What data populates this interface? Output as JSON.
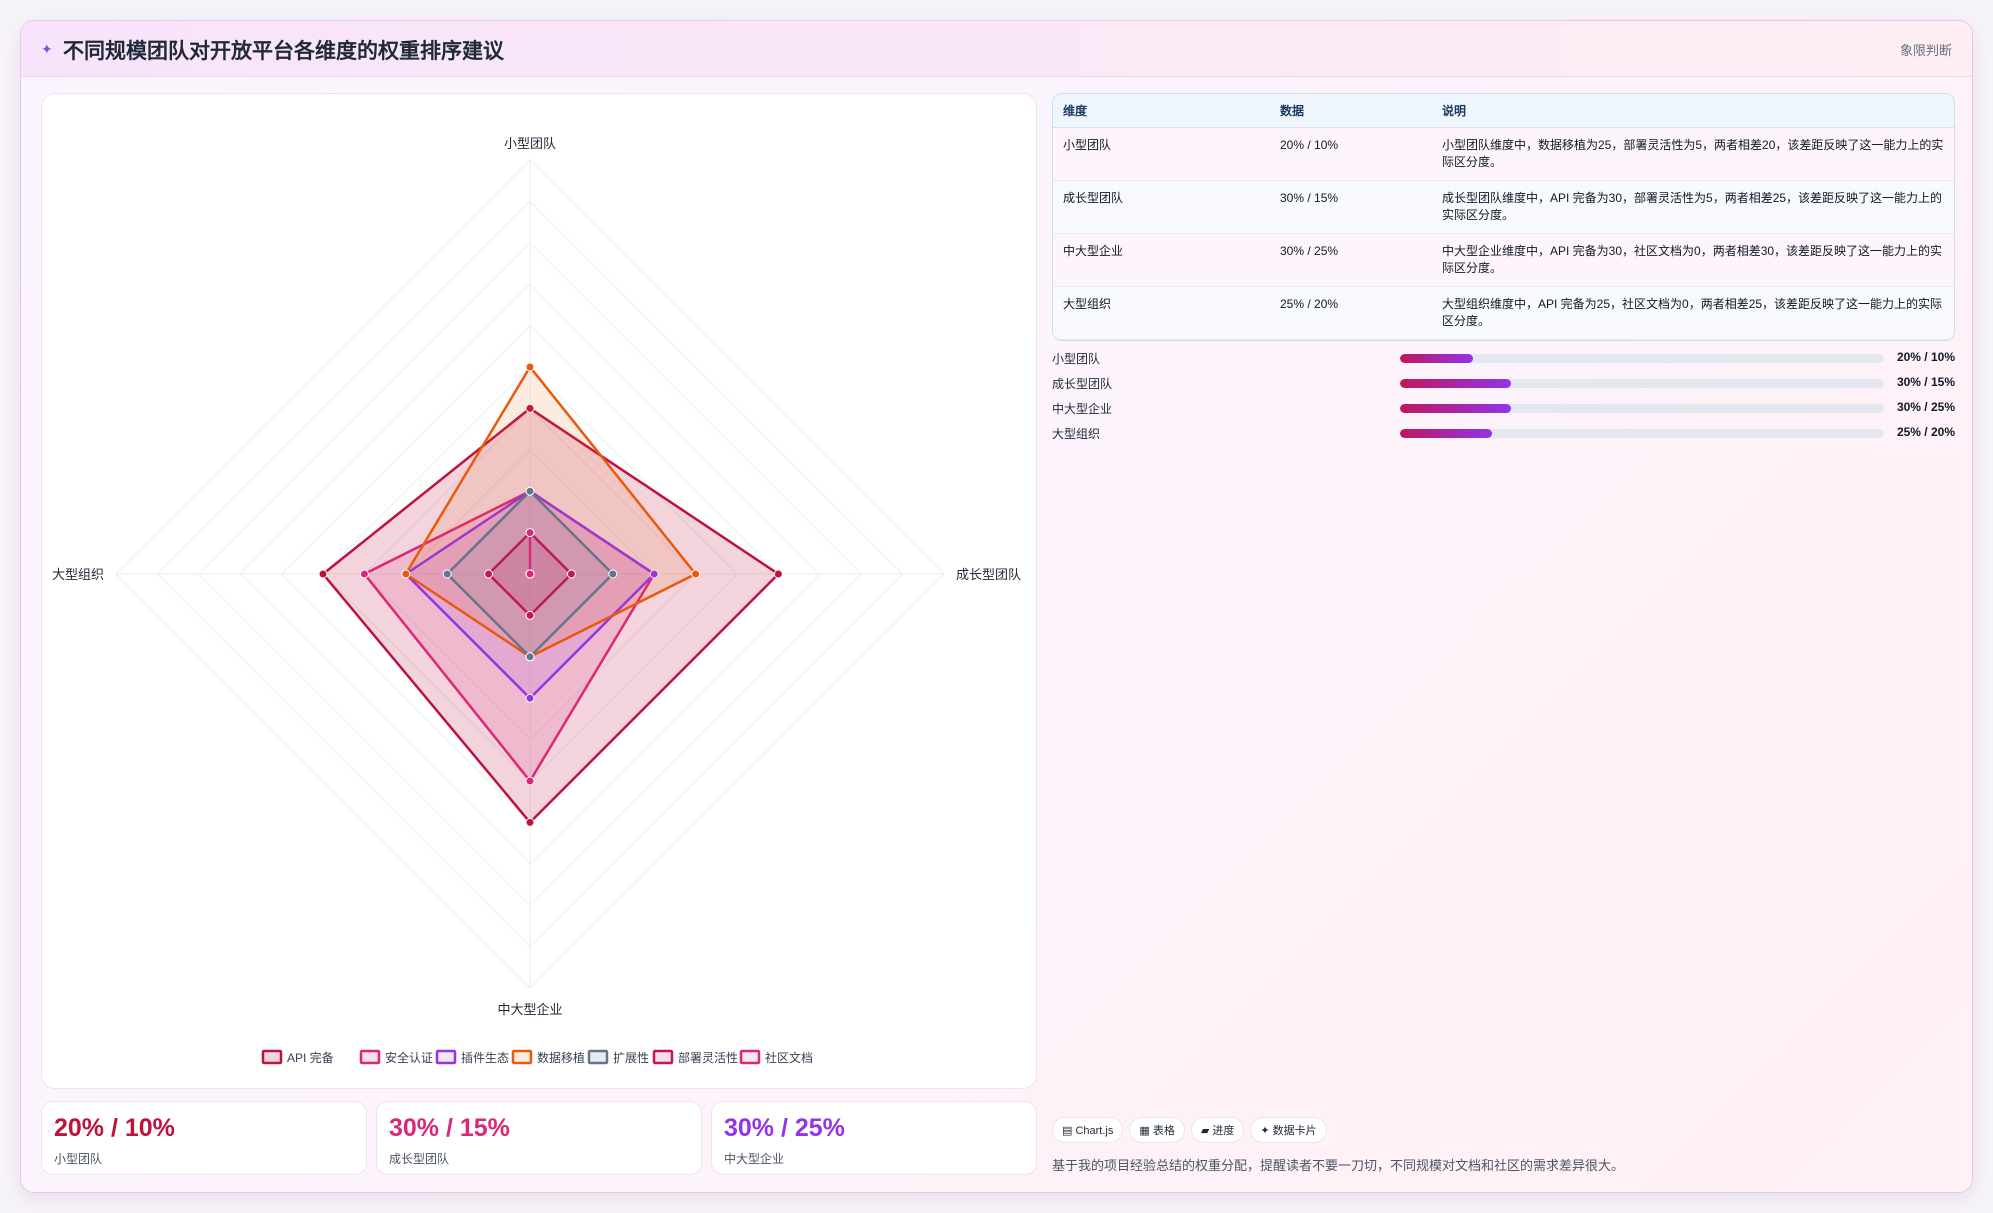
{
  "header": {
    "logo_icon": "✦",
    "title": "不同规模团队对开放平台各维度的权重排序建议",
    "tag": "象限判断"
  },
  "chart_data": {
    "type": "radar",
    "axes": [
      "小型团队",
      "成长型团队",
      "中大型企业",
      "大型组织"
    ],
    "range": [
      0,
      50
    ],
    "rings": 10,
    "series": [
      {
        "name": "API 完备",
        "color": "#be123c",
        "fill": "rgba(190,18,60,0.18)",
        "values": [
          20,
          30,
          30,
          25
        ]
      },
      {
        "name": "安全认证",
        "color": "#db2777",
        "fill": "rgba(219,39,119,0.15)",
        "values": [
          10,
          15,
          25,
          20
        ]
      },
      {
        "name": "插件生态",
        "color": "#9333ea",
        "fill": "rgba(147,51,234,0.12)",
        "values": [
          10,
          15,
          15,
          15
        ]
      },
      {
        "name": "数据移植",
        "color": "#ea580c",
        "fill": "rgba(234,88,12,0.12)",
        "values": [
          25,
          20,
          10,
          15
        ]
      },
      {
        "name": "扩展性",
        "color": "#64748b",
        "fill": "rgba(100,116,139,0.15)",
        "values": [
          10,
          10,
          10,
          10
        ]
      },
      {
        "name": "部署灵活性",
        "color": "#be185d",
        "fill": "rgba(190,24,93,0.14)",
        "values": [
          5,
          5,
          5,
          5
        ]
      },
      {
        "name": "社区文档",
        "color": "#db2777",
        "fill": "rgba(219,39,119,0.12)",
        "values": [
          5,
          0,
          0,
          0
        ]
      }
    ]
  },
  "stats": [
    {
      "value": "20% / 10%",
      "label": "小型团队",
      "color": "#be123c"
    },
    {
      "value": "30% / 15%",
      "label": "成长型团队",
      "color": "#db2777"
    },
    {
      "value": "30% / 25%",
      "label": "中大型企业",
      "color": "#9333ea"
    }
  ],
  "table": {
    "headers": [
      "维度",
      "数据",
      "说明"
    ],
    "rows": [
      {
        "dim": "小型团队",
        "data": "20% / 10%",
        "desc": "小型团队维度中，数据移植为25，部署灵活性为5，两者相差20，该差距反映了这一能力上的实际区分度。"
      },
      {
        "dim": "成长型团队",
        "data": "30% / 15%",
        "desc": "成长型团队维度中，API 完备为30，部署灵活性为5，两者相差25，该差距反映了这一能力上的实际区分度。"
      },
      {
        "dim": "中大型企业",
        "data": "30% / 25%",
        "desc": "中大型企业维度中，API 完备为30，社区文档为0，两者相差30，该差距反映了这一能力上的实际区分度。"
      },
      {
        "dim": "大型组织",
        "data": "25% / 20%",
        "desc": "大型组织维度中，API 完备为25，社区文档为0，两者相差25，该差距反映了这一能力上的实际区分度。"
      }
    ]
  },
  "progress": [
    {
      "label": "小型团队",
      "value": "20% / 10%",
      "percent": 15
    },
    {
      "label": "成长型团队",
      "value": "30% / 15%",
      "percent": 23
    },
    {
      "label": "中大型企业",
      "value": "30% / 25%",
      "percent": 23
    },
    {
      "label": "大型组织",
      "value": "25% / 20%",
      "percent": 19
    }
  ],
  "chips": [
    {
      "icon": "chart-icon",
      "glyph": "▤",
      "label": "Chart.js"
    },
    {
      "icon": "table-icon",
      "glyph": "▦",
      "label": "表格"
    },
    {
      "icon": "progress-icon",
      "glyph": "▰",
      "label": "进度"
    },
    {
      "icon": "card-icon",
      "glyph": "✦",
      "label": "数据卡片"
    }
  ],
  "note": "基于我的项目经验总结的权重分配，提醒读者不要一刀切，不同规模对文档和社区的需求差异很大。"
}
